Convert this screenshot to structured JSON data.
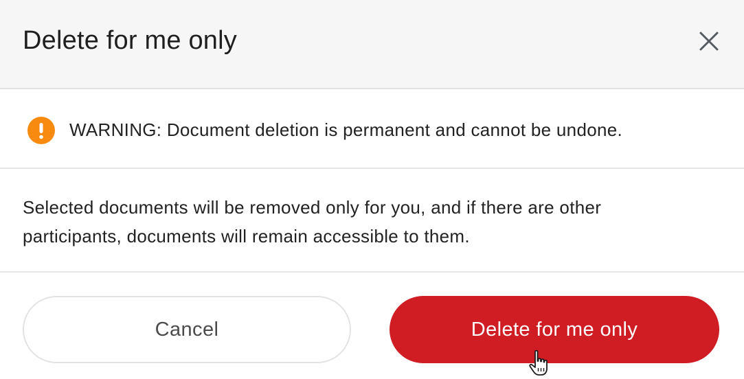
{
  "dialog": {
    "title": "Delete for me only",
    "close_icon": "close-icon"
  },
  "warning": {
    "icon": "exclamation-icon",
    "icon_color": "#f88a0f",
    "text": "WARNING: Document deletion is permanent and cannot be undone."
  },
  "body": {
    "text": "Selected documents will be removed only for you, and if there are other participants, documents will remain accessible to them."
  },
  "actions": {
    "cancel_label": "Cancel",
    "delete_label": "Delete for me only",
    "delete_color": "#d01d24"
  }
}
